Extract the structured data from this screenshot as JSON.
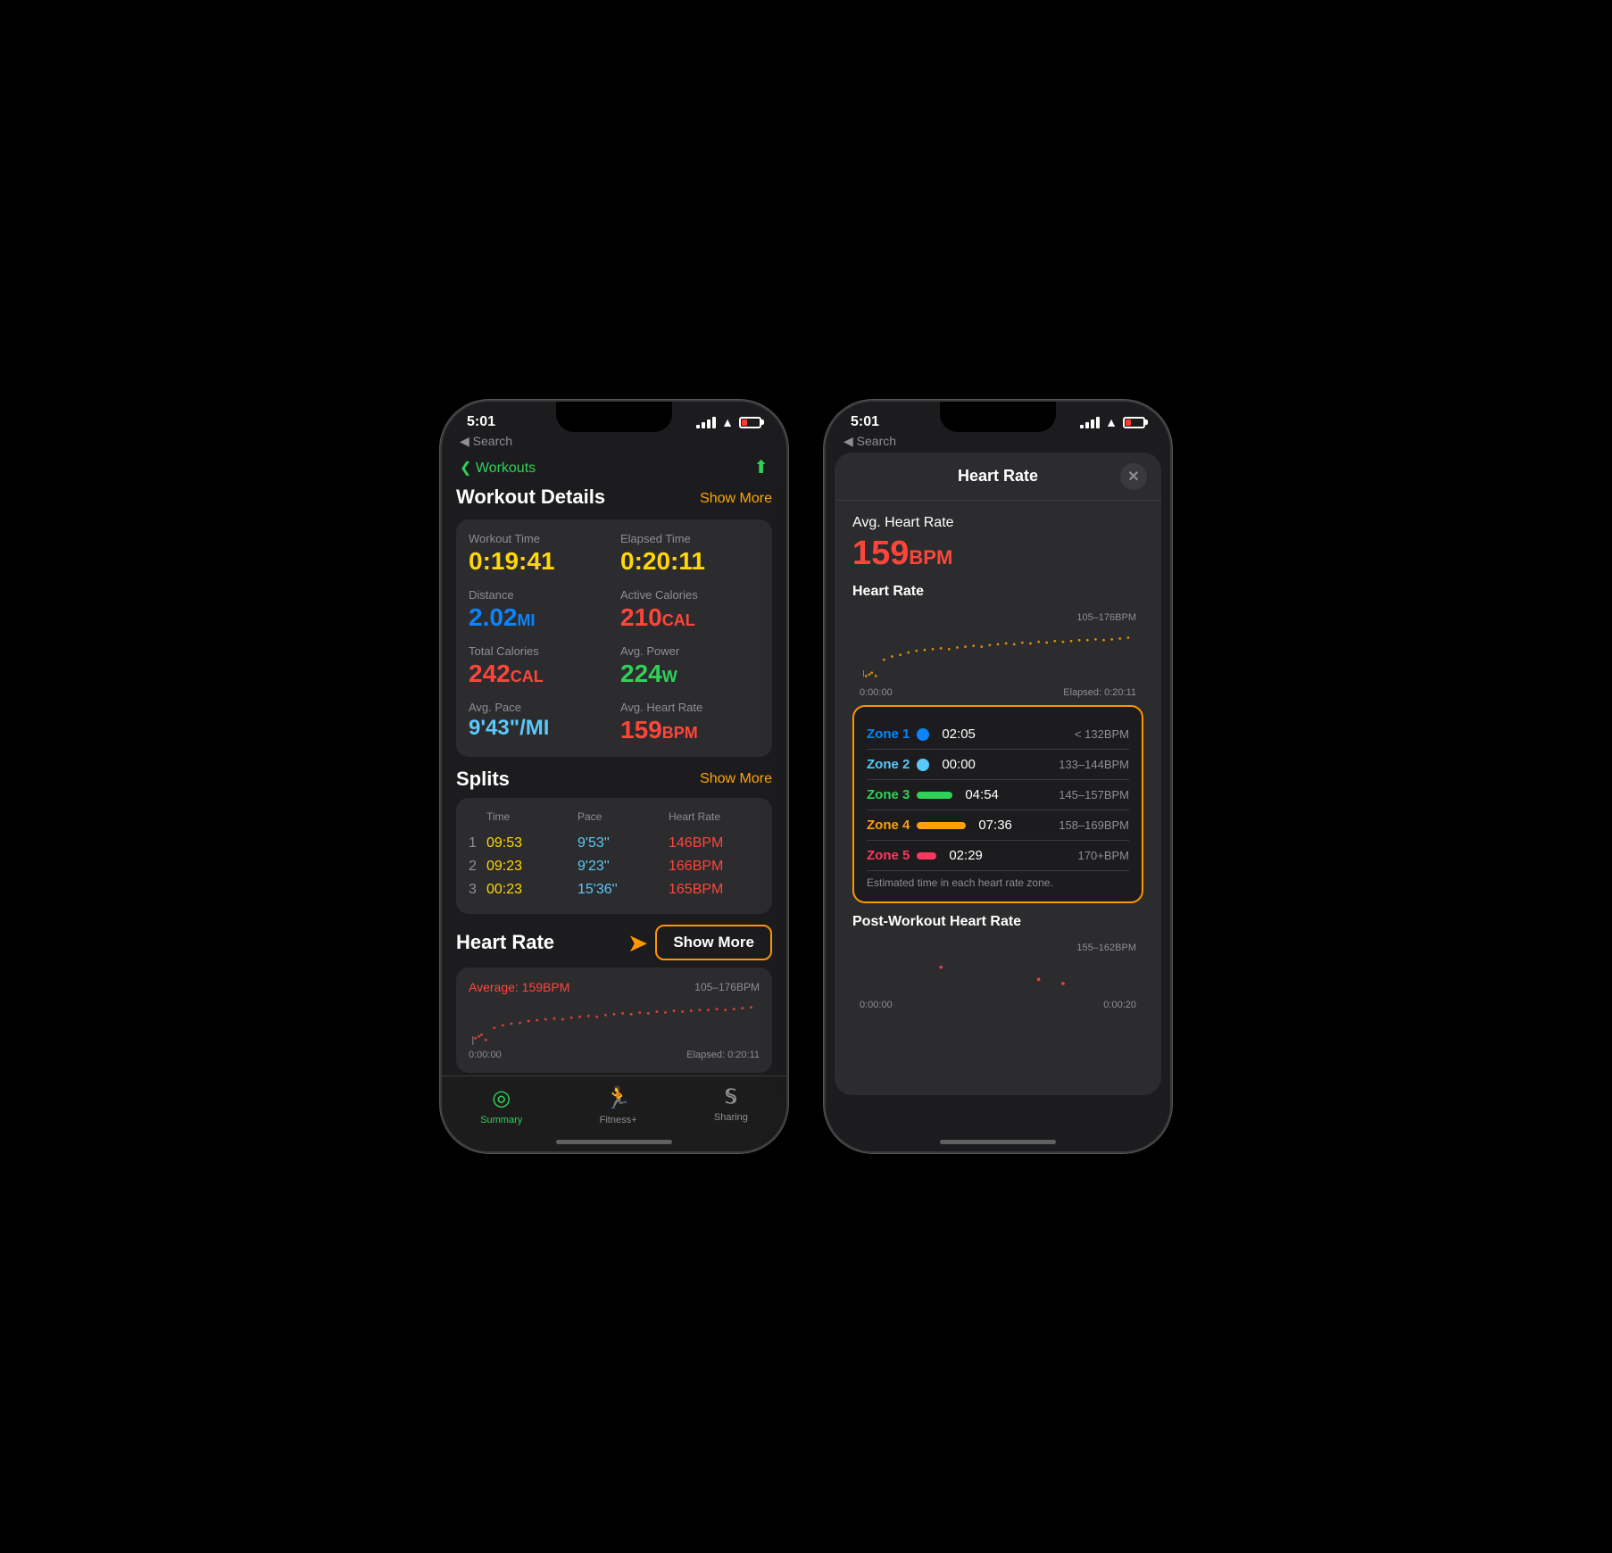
{
  "phones": {
    "phone1": {
      "status": {
        "time": "5:01",
        "back_label": "◀ Search"
      },
      "nav": {
        "back_label": "❮  Workouts",
        "share_icon": "⬆"
      },
      "workout_details": {
        "title": "Workout Details",
        "show_more": "Show More",
        "items": [
          {
            "label": "Workout Time",
            "value": "0:19:41",
            "color": "yellow"
          },
          {
            "label": "Elapsed Time",
            "value": "0:20:11",
            "color": "yellow"
          },
          {
            "label": "Distance",
            "value": "2.02",
            "unit": "MI",
            "color": "blue"
          },
          {
            "label": "Active Calories",
            "value": "210",
            "unit": "CAL",
            "color": "red"
          },
          {
            "label": "Total Calories",
            "value": "242",
            "unit": "CAL",
            "color": "red"
          },
          {
            "label": "Avg. Power",
            "value": "224",
            "unit": "W",
            "color": "green"
          },
          {
            "label": "Avg. Pace",
            "value": "9'43\"/MI",
            "color": "cyan"
          },
          {
            "label": "Avg. Heart Rate",
            "value": "159",
            "unit": "BPM",
            "color": "red"
          }
        ]
      },
      "splits": {
        "title": "Splits",
        "show_more": "Show More",
        "columns": [
          "",
          "Time",
          "Pace",
          "Heart Rate"
        ],
        "rows": [
          {
            "num": "1",
            "time": "09:53",
            "pace": "9'53''",
            "hr": "146BPM"
          },
          {
            "num": "2",
            "time": "09:23",
            "pace": "9'23''",
            "hr": "166BPM"
          },
          {
            "num": "3",
            "time": "00:23",
            "pace": "15'36''",
            "hr": "165BPM"
          }
        ]
      },
      "heart_rate": {
        "title": "Heart Rate",
        "show_more": "Show More",
        "avg_label": "Average: 159BPM",
        "range": "105–176BPM",
        "elapsed": "Elapsed: 0:20:11",
        "start": "0:00:00"
      },
      "tabs": [
        {
          "label": "Summary",
          "icon": "⊙",
          "active": true
        },
        {
          "label": "Fitness+",
          "icon": "🏃",
          "active": false
        },
        {
          "label": "Sharing",
          "icon": "S",
          "active": false
        }
      ]
    },
    "phone2": {
      "status": {
        "time": "5:01",
        "back_label": "◀ Search"
      },
      "modal": {
        "title": "Heart Rate",
        "close_icon": "✕",
        "avg_hr_label": "Avg. Heart Rate",
        "avg_hr_value": "159",
        "avg_hr_unit": "BPM",
        "chart_title": "Heart Rate",
        "chart_range": "105–176BPM",
        "chart_start": "0:00:00",
        "chart_elapsed": "Elapsed: 0:20:11",
        "zones": [
          {
            "name": "Zone 1",
            "color": "#0a84ff",
            "type": "dot",
            "time": "02:05",
            "range": "< 132BPM"
          },
          {
            "name": "Zone 2",
            "color": "#5ac8fa",
            "type": "dot",
            "time": "00:00",
            "range": "133–144BPM"
          },
          {
            "name": "Zone 3",
            "color": "#30d158",
            "type": "bar",
            "time": "04:54",
            "range": "145–157BPM"
          },
          {
            "name": "Zone 4",
            "color": "#ff9f0a",
            "type": "bar",
            "time": "07:36",
            "range": "158–169BPM"
          },
          {
            "name": "Zone 5",
            "color": "#ff375f",
            "type": "dot",
            "time": "02:29",
            "range": "170+BPM"
          }
        ],
        "zones_note": "Estimated time in each heart rate zone.",
        "post_hr_title": "Post-Workout Heart Rate",
        "post_hr_range": "155–162BPM",
        "post_start": "0:00:00",
        "post_elapsed": "0:00:20"
      }
    }
  }
}
